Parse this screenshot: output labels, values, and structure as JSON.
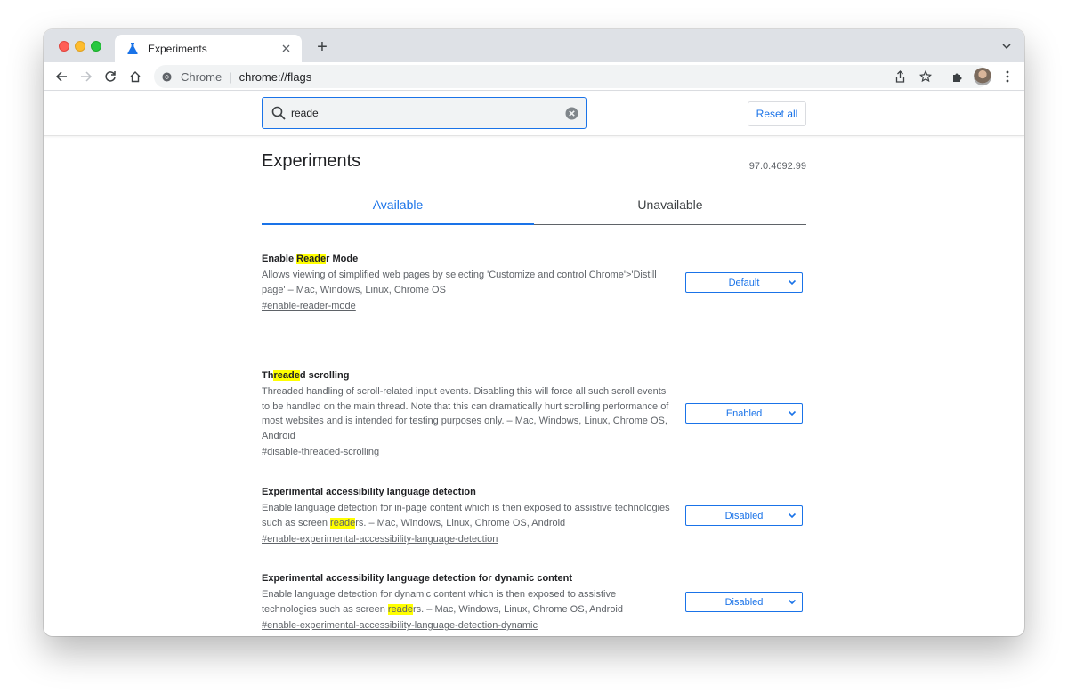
{
  "browser": {
    "tab_title": "Experiments",
    "new_tab": "+",
    "omnibox_site": "Chrome",
    "omnibox_separator": "|",
    "omnibox_url": "chrome://flags"
  },
  "flags_page": {
    "search_value": "reade",
    "reset_label": "Reset all",
    "title": "Experiments",
    "version": "97.0.4692.99",
    "tabs": [
      {
        "label": "Available",
        "active": true
      },
      {
        "label": "Unavailable",
        "active": false
      }
    ]
  },
  "flags": [
    {
      "name_parts": [
        "Enable ",
        "Reade",
        "r Mode"
      ],
      "desc_parts": [
        "Allows viewing of simplified web pages by selecting 'Customize and control Chrome'>'Distill page' – Mac, Windows, Linux, Chrome OS",
        "",
        ""
      ],
      "link": "#enable-reader-mode",
      "value": "Default"
    },
    {
      "name_parts": [
        "Th",
        "reade",
        "d scrolling"
      ],
      "desc_parts": [
        "Threaded handling of scroll-related input events. Disabling this will force all such scroll events to be handled on the main thread. Note that this can dramatically hurt scrolling performance of most websites and is intended for testing purposes only. – Mac, Windows, Linux, Chrome OS, Android",
        "",
        ""
      ],
      "link": "#disable-threaded-scrolling",
      "value": "Enabled"
    },
    {
      "name_parts": [
        "Experimental accessibility language detection",
        "",
        ""
      ],
      "desc_parts": [
        "Enable language detection for in-page content which is then exposed to assistive technologies such as screen ",
        "reade",
        "rs. – Mac, Windows, Linux, Chrome OS, Android"
      ],
      "link": "#enable-experimental-accessibility-language-detection",
      "value": "Disabled"
    },
    {
      "name_parts": [
        "Experimental accessibility language detection for dynamic content",
        "",
        ""
      ],
      "desc_parts": [
        "Enable language detection for dynamic content which is then exposed to assistive technologies such as screen ",
        "reade",
        "rs. – Mac, Windows, Linux, Chrome OS, Android"
      ],
      "link": "#enable-experimental-accessibility-language-detection-dynamic",
      "value": "Disabled"
    }
  ],
  "colors": {
    "accent": "#1a73e8",
    "highlight": "#ffff00",
    "titlebar": "#dee1e6"
  }
}
